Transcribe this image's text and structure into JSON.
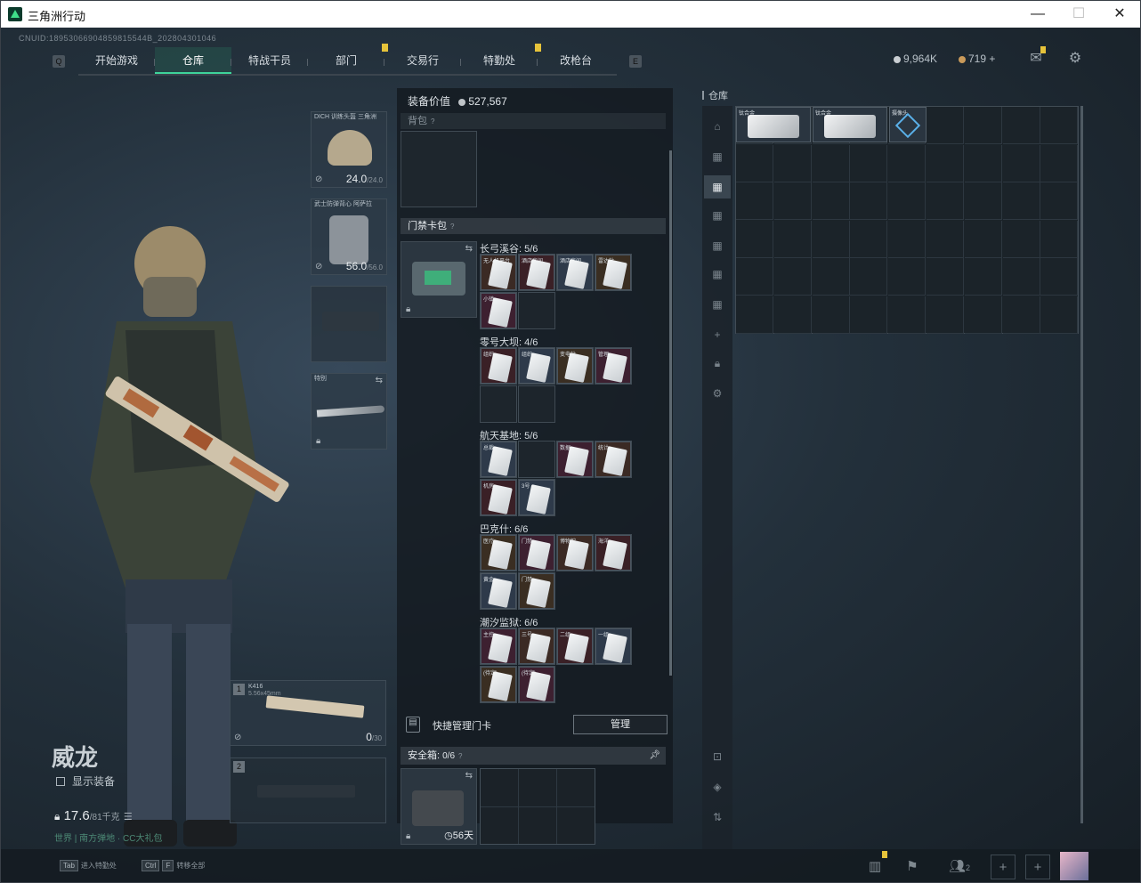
{
  "window": {
    "title": "三角洲行动",
    "min": "—",
    "max": "☐",
    "close": "✕"
  },
  "header": {
    "cnuid": "CNUID:18953066904859815544B_202804301046",
    "tabs": [
      {
        "label": "开始游戏"
      },
      {
        "label": "仓库",
        "active": true
      },
      {
        "label": "特战干员"
      },
      {
        "label": "部门",
        "badge": true
      },
      {
        "label": "交易行"
      },
      {
        "label": "特勤处",
        "badge": true
      },
      {
        "label": "改枪台"
      }
    ],
    "currency1": "9,964K",
    "currency2": "719 +"
  },
  "character": {
    "name": "威龙",
    "show_gear": "显示装备",
    "weight": "17.6",
    "weight_max": "/81千克",
    "caption": "世界 | 南方弹地 · CC大礼包",
    "helmet": {
      "label": "DICH 训练头盔 三角洲",
      "value": "24.0",
      "max": "/24.0"
    },
    "armor": {
      "label": "武士防弹背心 阿萨拉",
      "value": "56.0",
      "max": "/56.0"
    },
    "melee": {
      "label": "特别"
    },
    "primary": {
      "label": "K416",
      "sub": "5.56x45mm",
      "ammo": "0",
      "ammo_max": "/30",
      "slot": "1"
    },
    "secondary": {
      "slot": "2"
    }
  },
  "middle": {
    "equip_value_label": "装备价值",
    "equip_value": "527,567",
    "backpack_label": "背包",
    "keycard_label": "门禁卡包",
    "groups": [
      {
        "name": "长弓溪谷: 5/6",
        "cards": [
          "无人机平台",
          "酒店房间",
          "酒店房间",
          "雷达站",
          "小镇"
        ]
      },
      {
        "name": "零号大坝: 4/6",
        "cards": [
          "组织",
          "组织",
          "变电站",
          "管理"
        ]
      },
      {
        "name": "航天基地: 5/6",
        "cards": [
          "总裁",
          "",
          "数据",
          "统计",
          "机房",
          "3号"
        ]
      },
      {
        "name": "巴克什: 6/6",
        "cards": [
          "医疗",
          "门禁",
          "博物馆",
          "海洋",
          "黄金",
          "门禁"
        ]
      },
      {
        "name": "潮汐监狱: 6/6",
        "cards": [
          "主控",
          "三号",
          "二组",
          "一组",
          "(待定)",
          "(待定)"
        ]
      }
    ],
    "quick_manage": "快捷管理门卡",
    "manage_btn": "管理",
    "safe_label": "安全箱:",
    "safe_count": "0/6",
    "safe_days": "56天"
  },
  "right": {
    "title": "仓库",
    "items": [
      {
        "label": "钛合金"
      },
      {
        "label": "钛合金"
      },
      {
        "label": "摄像头"
      }
    ]
  },
  "bottom": {
    "hint1_key": "Tab",
    "hint1": "进入特勤处",
    "hint2_key1": "Ctrl",
    "hint2_key2": "F",
    "hint2": "转移全部",
    "friends": "2"
  }
}
